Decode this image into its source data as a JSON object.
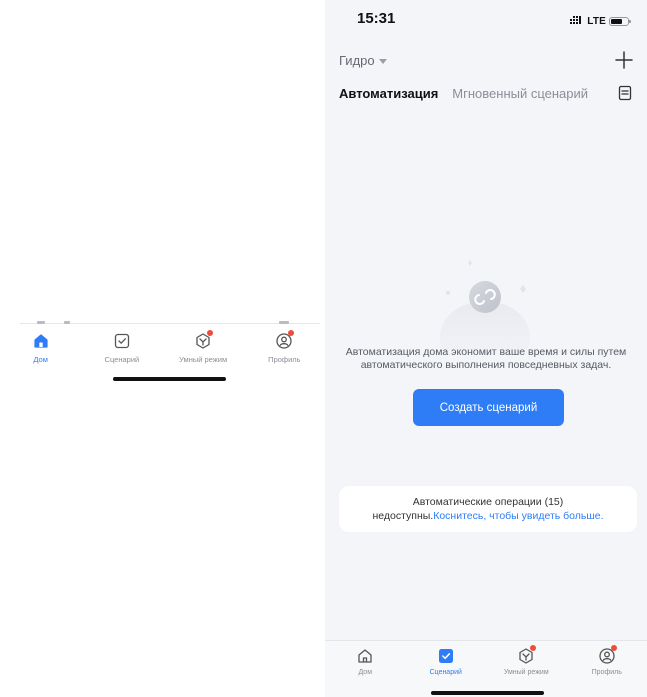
{
  "left_fragment": {
    "tabs": [
      {
        "id": "home",
        "label": "Дом",
        "icon": "home-icon",
        "active": true,
        "badge": false
      },
      {
        "id": "scene",
        "label": "Сценарий",
        "icon": "scene-check-icon",
        "active": false,
        "badge": false
      },
      {
        "id": "smart",
        "label": "Умный режим",
        "icon": "smart-mode-icon",
        "active": false,
        "badge": true
      },
      {
        "id": "profile",
        "label": "Профиль",
        "icon": "profile-icon",
        "active": false,
        "badge": true
      }
    ]
  },
  "status_bar": {
    "time": "15:31",
    "network": "LTE",
    "signal_icon": "signal-icon",
    "battery_icon": "battery-icon"
  },
  "header": {
    "home_name": "Гидро",
    "add_icon": "plus-icon"
  },
  "tabs": {
    "automation": "Автоматизация",
    "instant": "Мгновенный сценарий",
    "log_icon": "log-icon"
  },
  "empty_state": {
    "illustration_icon": "automation-loop-icon",
    "text": "Автоматизация дома экономит ваше время и силы путем автоматического выполнения повседневных задач.",
    "create_button": "Создать сценарий"
  },
  "notice": {
    "text_line1": "Автоматические операции (15)",
    "text_prefix": "недоступны.",
    "link_text": "Коснитесь, чтобы увидеть больше."
  },
  "bottom_tabs": [
    {
      "id": "home",
      "label": "Дом",
      "icon": "home-icon",
      "active": false,
      "badge": false
    },
    {
      "id": "scene",
      "label": "Сценарий",
      "icon": "scene-check-icon",
      "active": true,
      "badge": false
    },
    {
      "id": "smart",
      "label": "Умный режим",
      "icon": "smart-mode-icon",
      "active": false,
      "badge": true
    },
    {
      "id": "profile",
      "label": "Профиль",
      "icon": "profile-icon",
      "active": false,
      "badge": true
    }
  ],
  "colors": {
    "accent": "#2f7df6",
    "badge": "#ee4d3c",
    "background": "#f4f5f9"
  }
}
